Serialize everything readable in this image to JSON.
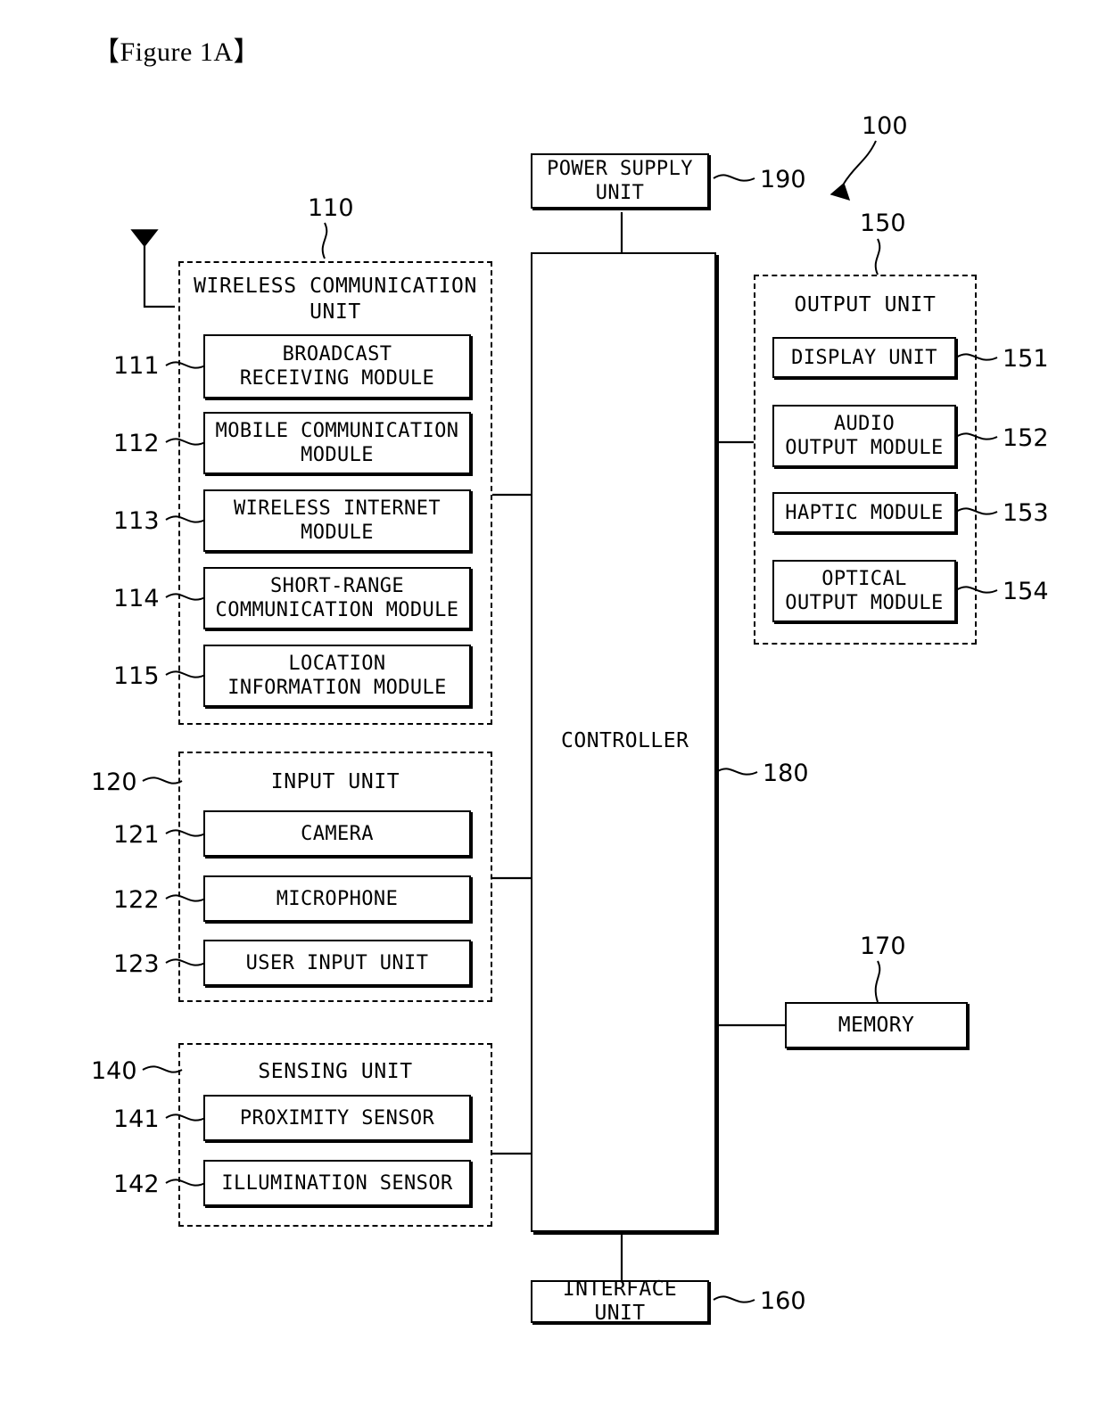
{
  "figure": {
    "title": "【Figure 1A】",
    "device_ref": "100"
  },
  "blocks": {
    "power_supply": {
      "label": "POWER SUPPLY\nUNIT",
      "ref": "190"
    },
    "controller": {
      "label": "CONTROLLER",
      "ref": "180"
    },
    "memory": {
      "label": "MEMORY",
      "ref": "170"
    },
    "interface": {
      "label": "INTERFACE UNIT",
      "ref": "160"
    }
  },
  "wireless_unit": {
    "title": "WIRELESS COMMUNICATION\nUNIT",
    "ref": "110",
    "modules": [
      {
        "label": "BROADCAST\nRECEIVING MODULE",
        "ref": "111"
      },
      {
        "label": "MOBILE COMMUNICATION\nMODULE",
        "ref": "112"
      },
      {
        "label": "WIRELESS INTERNET\nMODULE",
        "ref": "113"
      },
      {
        "label": "SHORT-RANGE\nCOMMUNICATION MODULE",
        "ref": "114"
      },
      {
        "label": "LOCATION\nINFORMATION MODULE",
        "ref": "115"
      }
    ]
  },
  "input_unit": {
    "title": "INPUT UNIT",
    "ref": "120",
    "modules": [
      {
        "label": "CAMERA",
        "ref": "121"
      },
      {
        "label": "MICROPHONE",
        "ref": "122"
      },
      {
        "label": "USER INPUT UNIT",
        "ref": "123"
      }
    ]
  },
  "sensing_unit": {
    "title": "SENSING UNIT",
    "ref": "140",
    "modules": [
      {
        "label": "PROXIMITY SENSOR",
        "ref": "141"
      },
      {
        "label": "ILLUMINATION SENSOR",
        "ref": "142"
      }
    ]
  },
  "output_unit": {
    "title": "OUTPUT UNIT",
    "ref": "150",
    "modules": [
      {
        "label": "DISPLAY UNIT",
        "ref": "151"
      },
      {
        "label": "AUDIO\nOUTPUT MODULE",
        "ref": "152"
      },
      {
        "label": "HAPTIC MODULE",
        "ref": "153"
      },
      {
        "label": "OPTICAL\nOUTPUT MODULE",
        "ref": "154"
      }
    ]
  },
  "icons": {
    "antenna": "antenna-icon",
    "pointer": "arrow-pointer-icon"
  },
  "colors": {
    "line": "#000000",
    "background": "#ffffff"
  }
}
